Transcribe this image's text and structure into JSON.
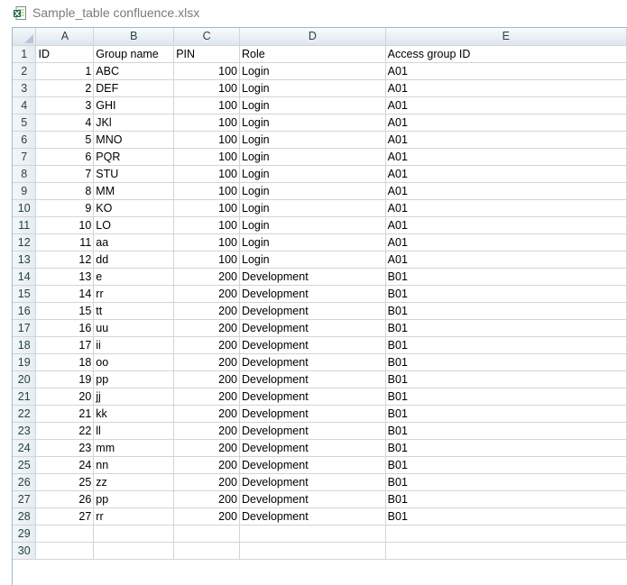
{
  "window": {
    "title": "Sample_table confluence.xlsx",
    "icon": "excel-file-icon",
    "accent": "#1f7145"
  },
  "sheet": {
    "columns": [
      "A",
      "B",
      "C",
      "D",
      "E"
    ],
    "row_numbers": [
      "1",
      "2",
      "3",
      "4",
      "5",
      "6",
      "7",
      "8",
      "9",
      "10",
      "11",
      "12",
      "13",
      "14",
      "15",
      "16",
      "17",
      "18",
      "19",
      "20",
      "21",
      "22",
      "23",
      "24",
      "25",
      "26",
      "27",
      "28",
      "29",
      "30"
    ],
    "rows": [
      [
        "ID",
        "Group name",
        "PIN",
        "Role",
        "Access group ID"
      ],
      [
        "1",
        "ABC",
        "100",
        "Login",
        "A01"
      ],
      [
        "2",
        "DEF",
        "100",
        "Login",
        "A01"
      ],
      [
        "3",
        "GHI",
        "100",
        "Login",
        "A01"
      ],
      [
        "4",
        "JKl",
        "100",
        "Login",
        "A01"
      ],
      [
        "5",
        "MNO",
        "100",
        "Login",
        "A01"
      ],
      [
        "6",
        "PQR",
        "100",
        "Login",
        "A01"
      ],
      [
        "7",
        "STU",
        "100",
        "Login",
        "A01"
      ],
      [
        "8",
        "MM",
        "100",
        "Login",
        "A01"
      ],
      [
        "9",
        "KO",
        "100",
        "Login",
        "A01"
      ],
      [
        "10",
        "LO",
        "100",
        "Login",
        "A01"
      ],
      [
        "11",
        "aa",
        "100",
        "Login",
        "A01"
      ],
      [
        "12",
        "dd",
        "100",
        "Login",
        "A01"
      ],
      [
        "13",
        "e",
        "200",
        "Development",
        "B01"
      ],
      [
        "14",
        "rr",
        "200",
        "Development",
        "B01"
      ],
      [
        "15",
        "tt",
        "200",
        "Development",
        "B01"
      ],
      [
        "16",
        "uu",
        "200",
        "Development",
        "B01"
      ],
      [
        "17",
        "ii",
        "200",
        "Development",
        "B01"
      ],
      [
        "18",
        "oo",
        "200",
        "Development",
        "B01"
      ],
      [
        "19",
        "pp",
        "200",
        "Development",
        "B01"
      ],
      [
        "20",
        "jj",
        "200",
        "Development",
        "B01"
      ],
      [
        "21",
        "kk",
        "200",
        "Development",
        "B01"
      ],
      [
        "22",
        "ll",
        "200",
        "Development",
        "B01"
      ],
      [
        "23",
        "mm",
        "200",
        "Development",
        "B01"
      ],
      [
        "24",
        "nn",
        "200",
        "Development",
        "B01"
      ],
      [
        "25",
        "zz",
        "200",
        "Development",
        "B01"
      ],
      [
        "26",
        "pp",
        "200",
        "Development",
        "B01"
      ],
      [
        "27",
        "rr",
        "200",
        "Development",
        "B01"
      ],
      [
        "",
        "",
        "",
        "",
        ""
      ],
      [
        "",
        "",
        "",
        "",
        ""
      ]
    ]
  }
}
